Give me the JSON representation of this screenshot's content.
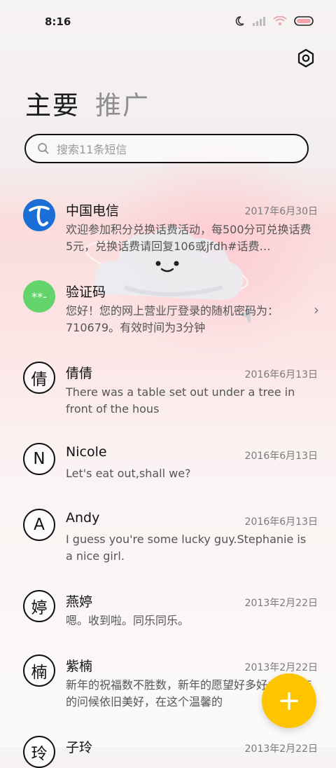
{
  "status": {
    "time": "8:16"
  },
  "tabs": [
    {
      "label": "主要"
    },
    {
      "label": "推广"
    }
  ],
  "search": {
    "placeholder": "搜索11条短信"
  },
  "messages": [
    {
      "name": "中国电信",
      "date": "2017年6月30日",
      "preview": "欢迎参加积分兑换话费活动，每500分可兑换话费5元，兑换话费请回复106或jfdh#话费…",
      "avatar": ""
    },
    {
      "name": "验证码",
      "date": "",
      "preview": "您好！您的网上营业厅登录的随机密码为：710679。有效时间为3分钟",
      "avatar": "**-"
    },
    {
      "name": "倩倩",
      "date": "2016年6月13日",
      "preview": "There was a table set out under a tree in front of the hous",
      "avatar": "倩"
    },
    {
      "name": "Nicole",
      "date": "2016年6月13日",
      "preview": "Let's eat out,shall we?",
      "avatar": "N"
    },
    {
      "name": "Andy",
      "date": "2016年6月13日",
      "preview": "I guess you're some lucky guy.Stephanie is a nice girl.",
      "avatar": "A"
    },
    {
      "name": "燕婷",
      "date": "2013年2月22日",
      "preview": "嗯。收到啦。同乐同乐。",
      "avatar": "婷"
    },
    {
      "name": "紫楠",
      "date": "2013年2月22日",
      "preview": "新年的祝福数不胜数，新年的愿望好多好多，新年的问候依旧美好，在这个温馨的",
      "avatar": "楠"
    },
    {
      "name": "子玲",
      "date": "2013年2月22日",
      "preview": "",
      "avatar": "玲"
    }
  ],
  "fab": {
    "label": "+"
  },
  "colors": {
    "fab": "#ffc400",
    "verify_avatar": "#63d36b",
    "telecom_blue": "#1b6ed6"
  }
}
